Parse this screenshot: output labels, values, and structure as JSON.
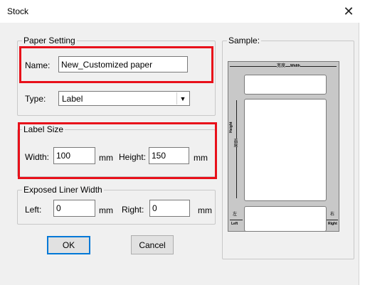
{
  "window": {
    "title": "Stock",
    "close_glyph": "✕"
  },
  "paper_setting": {
    "legend": "Paper Setting",
    "name_label": "Name:",
    "name_value": "New_Customized paper",
    "type_label": "Type:",
    "type_value": "Label"
  },
  "label_size": {
    "legend": "Label Size",
    "width_label": "Width:",
    "width_value": "100",
    "width_unit": "mm",
    "height_label": "Height:",
    "height_value": "150",
    "height_unit": "mm"
  },
  "liner": {
    "legend": "Exposed Liner Width",
    "left_label": "Left:",
    "left_value": "0",
    "left_unit": "mm",
    "right_label": "Right:",
    "right_value": "0",
    "right_unit": "mm"
  },
  "buttons": {
    "ok": "OK",
    "cancel": "Cancel"
  },
  "sample": {
    "legend": "Sample:",
    "width_cn": "宽度",
    "width_en": "Width",
    "height_cn": "高度",
    "height_en": "Height",
    "left_cn": "左",
    "left_en": "Left",
    "right_cn": "右",
    "right_en": "Right"
  },
  "colors": {
    "highlight": "#e8101a",
    "focus": "#0078d7"
  }
}
